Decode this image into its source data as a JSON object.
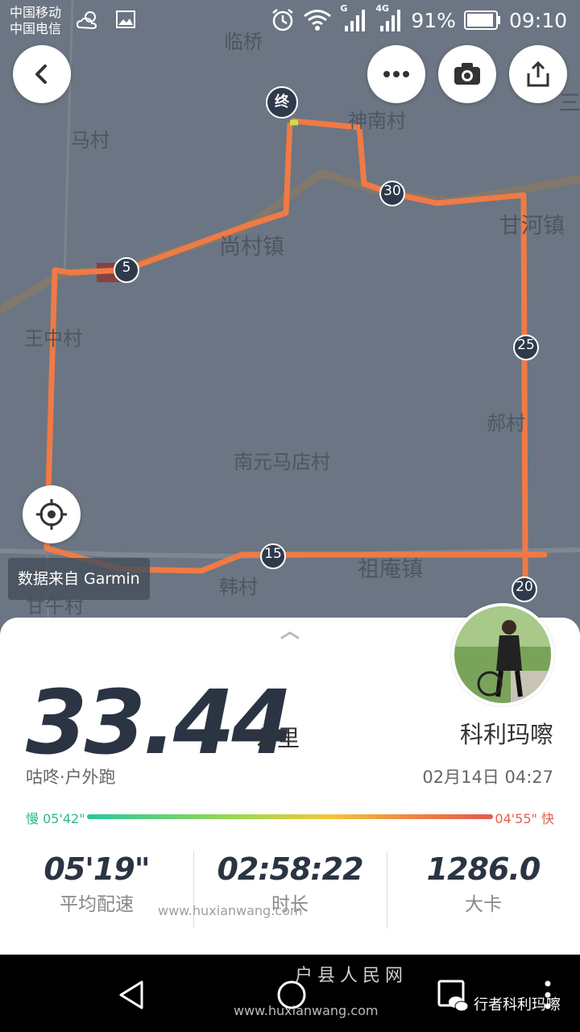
{
  "status_bar": {
    "carrier1": "中国移动",
    "carrier2": "中国电信",
    "network1": "G",
    "network2": "4G",
    "battery": "91%",
    "time": "09:10"
  },
  "map": {
    "places": [
      "临桥",
      "马村",
      "神南村",
      "尚村镇",
      "甘河镇",
      "王中村",
      "郝村",
      "南元马店村",
      "韩村",
      "祖庵镇",
      "甘午村",
      "三"
    ],
    "markers": {
      "end": "终",
      "km5": "5",
      "km15": "15",
      "km20": "20",
      "km25": "25",
      "km30": "30"
    },
    "data_source": "数据来自 Garmin"
  },
  "summary": {
    "distance": "33.44",
    "distance_unit": "公里",
    "activity": "咕咚·户外跑",
    "username": "科利玛嚓",
    "datetime": "02月14日 04:27",
    "pace_slow": "慢 05'42\"",
    "pace_fast": "04'55\" 快",
    "stats": [
      {
        "value": "05'19\"",
        "label": "平均配速"
      },
      {
        "value": "02:58:22",
        "label": "时长"
      },
      {
        "value": "1286.0",
        "label": "大卡"
      }
    ],
    "watermark": "www.huxianwang.com"
  },
  "nav_bar": {
    "watermark_title": "户县人民网",
    "watermark_url": "www.huxianwang.com",
    "wechat_account": "行者科利玛嚓"
  },
  "colors": {
    "route": "#f07a45",
    "pace_slow": "#2db88a",
    "pace_fast": "#e4604d",
    "map_bg": "#6b7583"
  }
}
